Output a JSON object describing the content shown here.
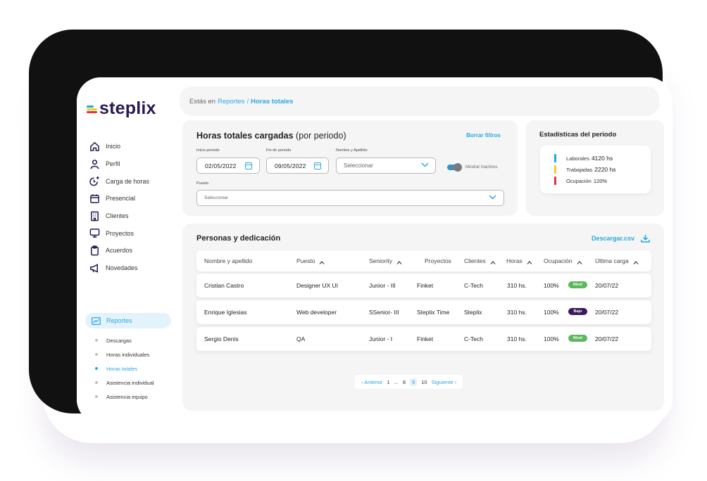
{
  "brand": {
    "name": "steplix",
    "colors": {
      "primary": "#2a1950",
      "accent": "#2aa7e0",
      "yellow": "#f2d024",
      "red": "#e6303b",
      "green": "#5cb85c",
      "purple": "#3a1a5c"
    }
  },
  "sidebar": {
    "items": [
      {
        "label": "Inicio",
        "icon": "home-icon"
      },
      {
        "label": "Perfil",
        "icon": "user-icon"
      },
      {
        "label": "Carga de horas",
        "icon": "clock-plus-icon"
      },
      {
        "label": "Presencial",
        "icon": "calendar-icon"
      },
      {
        "label": "Clientes",
        "icon": "building-icon"
      },
      {
        "label": "Proyectos",
        "icon": "monitor-icon"
      },
      {
        "label": "Acuerdos",
        "icon": "clipboard-icon"
      },
      {
        "label": "Novedades",
        "icon": "megaphone-icon"
      }
    ],
    "reports": {
      "label": "Reportes",
      "icon": "chart-line-icon"
    },
    "sub_items": [
      {
        "label": "Descargas",
        "active": false
      },
      {
        "label": "Horas individuales",
        "active": false
      },
      {
        "label": "Horas totales",
        "active": true
      },
      {
        "label": "Asistencia individual",
        "active": false
      },
      {
        "label": "Asistencia equipo",
        "active": false
      }
    ]
  },
  "breadcrumb": {
    "prefix": "Estás en",
    "parent": "Reportes",
    "separator": "/",
    "current": "Horas totales"
  },
  "filters": {
    "title_bold": "Horas totales cargadas",
    "title_normal": "(por periodo)",
    "clear_label": "Borrar filtros",
    "start_label": "Inicio periodo",
    "start_value": "02/05/2022",
    "end_label": "Fin de periodo",
    "end_value": "09/05/2022",
    "name_label": "Nombre y Apellido",
    "name_placeholder": "Seleccionar",
    "toggle_label": "Mostrar inactivos",
    "toggle_on": true,
    "position_label": "Puesto",
    "position_placeholder": "Seleccionar"
  },
  "stats": {
    "title": "Estadísticas del periodo",
    "rows": [
      {
        "label": "Laborales",
        "value": "4120 hs",
        "color": "#1fa8e0"
      },
      {
        "label": "Trabajadas",
        "value": "2220 hs",
        "color": "#f2d024"
      },
      {
        "label": "Ocupación",
        "value": "120%",
        "color": "#e6303b"
      }
    ]
  },
  "people": {
    "title": "Personas y dedicación",
    "download_label": "Descargar.csv",
    "columns": [
      "Nombre y apellido",
      "Puesto",
      "Seniority",
      "Proyectos",
      "Clientes",
      "Horas",
      "Ocupación",
      "Última carga"
    ],
    "rows": [
      {
        "name": "Cristian Castro",
        "position": "Designer UX UI",
        "seniority": "Junior - III",
        "project": "Finket",
        "client": "C-Tech",
        "hours": "310  hs.",
        "occupation": "100%",
        "badge": "Nivel",
        "badge_color": "#5cb85c",
        "last": "20/07/22"
      },
      {
        "name": "Enrique Iglesias",
        "position": "Web developer",
        "seniority": "SSenior- III",
        "project": "Steplix Time",
        "client": "Steplix",
        "hours": "310  hs.",
        "occupation": "100%",
        "badge": "Bajo",
        "badge_color": "#3a1a5c",
        "last": "20/07/22"
      },
      {
        "name": "Sergio Denis",
        "position": "QA",
        "seniority": "Junior - I",
        "project": "Finket",
        "client": "C-Tech",
        "hours": "310  hs.",
        "occupation": "100%",
        "badge": "Nivel",
        "badge_color": "#5cb85c",
        "last": "20/07/22"
      }
    ]
  },
  "pagination": {
    "prev": "Anterior",
    "first": "1",
    "ellipsis": "...",
    "p8": "8",
    "current": "9",
    "p10": "10",
    "next": "Siguiente"
  }
}
